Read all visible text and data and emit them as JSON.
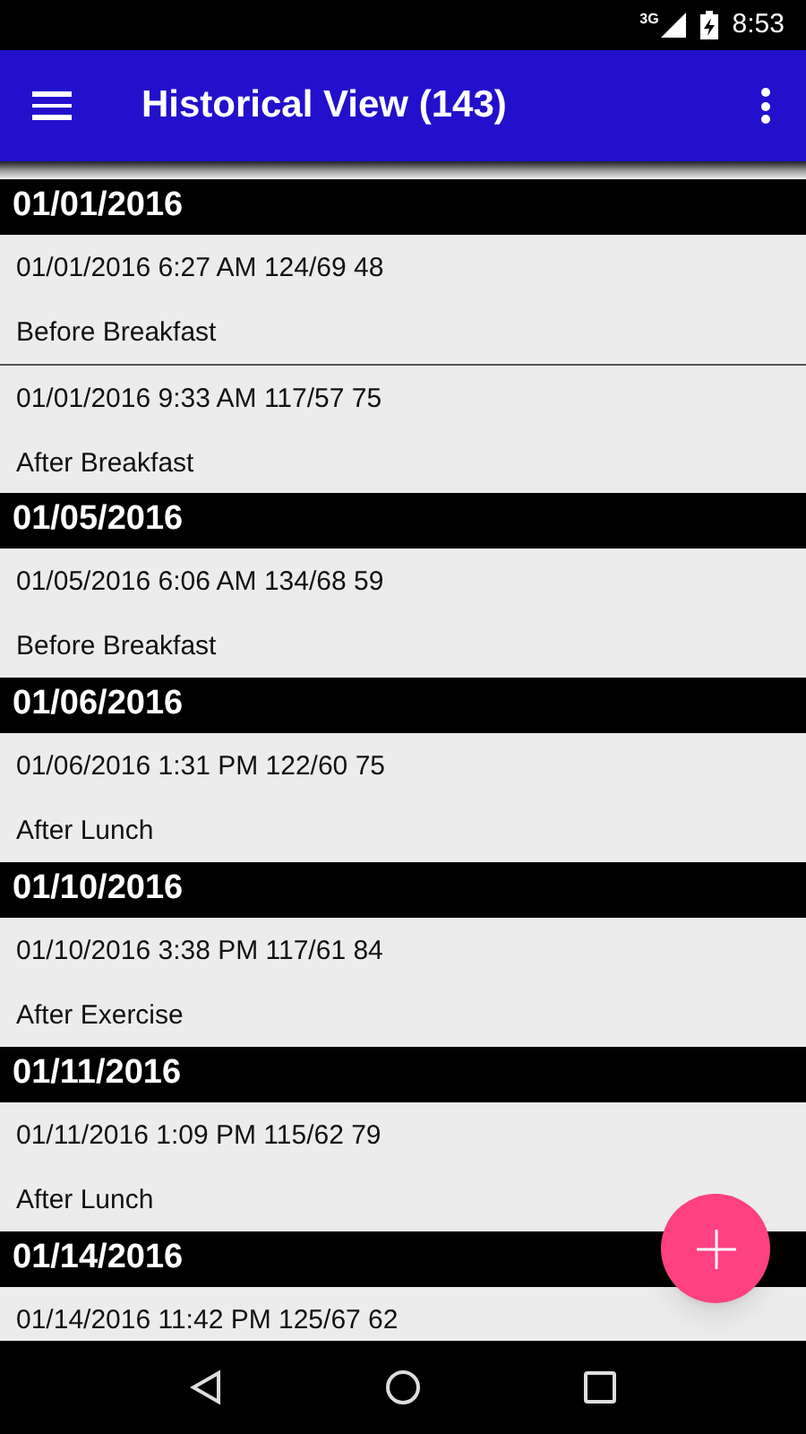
{
  "status_bar": {
    "network": "3G",
    "time": "8:53"
  },
  "app_bar": {
    "title": "Historical View (143)"
  },
  "groups": [
    {
      "date": "01/01/2016",
      "entries": [
        {
          "reading": "01/01/2016 6:27 AM 124/69 48",
          "note": "Before Breakfast"
        },
        {
          "reading": "01/01/2016 9:33 AM 117/57 75",
          "note": "After Breakfast"
        }
      ]
    },
    {
      "date": "01/05/2016",
      "entries": [
        {
          "reading": "01/05/2016 6:06 AM 134/68 59",
          "note": "Before Breakfast"
        }
      ]
    },
    {
      "date": "01/06/2016",
      "entries": [
        {
          "reading": "01/06/2016 1:31 PM 122/60 75",
          "note": "After Lunch"
        }
      ]
    },
    {
      "date": "01/10/2016",
      "entries": [
        {
          "reading": "01/10/2016 3:38 PM 117/61 84",
          "note": "After Exercise"
        }
      ]
    },
    {
      "date": "01/11/2016",
      "entries": [
        {
          "reading": "01/11/2016 1:09 PM 115/62 79",
          "note": "After Lunch"
        }
      ]
    },
    {
      "date": "01/14/2016",
      "entries": [
        {
          "reading": "01/14/2016 11:42 PM 125/67 62"
        }
      ]
    }
  ]
}
